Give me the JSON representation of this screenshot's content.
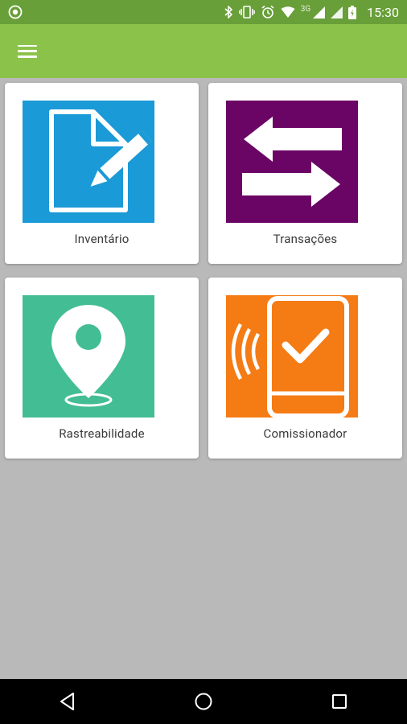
{
  "status_bar": {
    "time": "15:30",
    "network": "3G",
    "icons": [
      "app-notification-icon",
      "bluetooth-icon",
      "vibrate-icon",
      "alarm-icon",
      "wifi-icon",
      "signal-icon",
      "signal-icon",
      "battery-icon"
    ]
  },
  "app_bar": {
    "menu_icon": "hamburger-menu-icon",
    "background": "#8bc34a",
    "status_background": "#689f38"
  },
  "tiles": [
    {
      "label": "Inventário",
      "icon": "edit-document-icon",
      "color": "#1a9ad7"
    },
    {
      "label": "Transações",
      "icon": "swap-arrows-icon",
      "color": "#6b0565"
    },
    {
      "label": "Rastreabilidade",
      "icon": "location-pin-icon",
      "color": "#43bd94"
    },
    {
      "label": "Comissionador",
      "icon": "nfc-phone-check-icon",
      "color": "#f57b14"
    }
  ],
  "nav_bar": {
    "buttons": [
      "back-icon",
      "home-icon",
      "recents-icon"
    ]
  }
}
